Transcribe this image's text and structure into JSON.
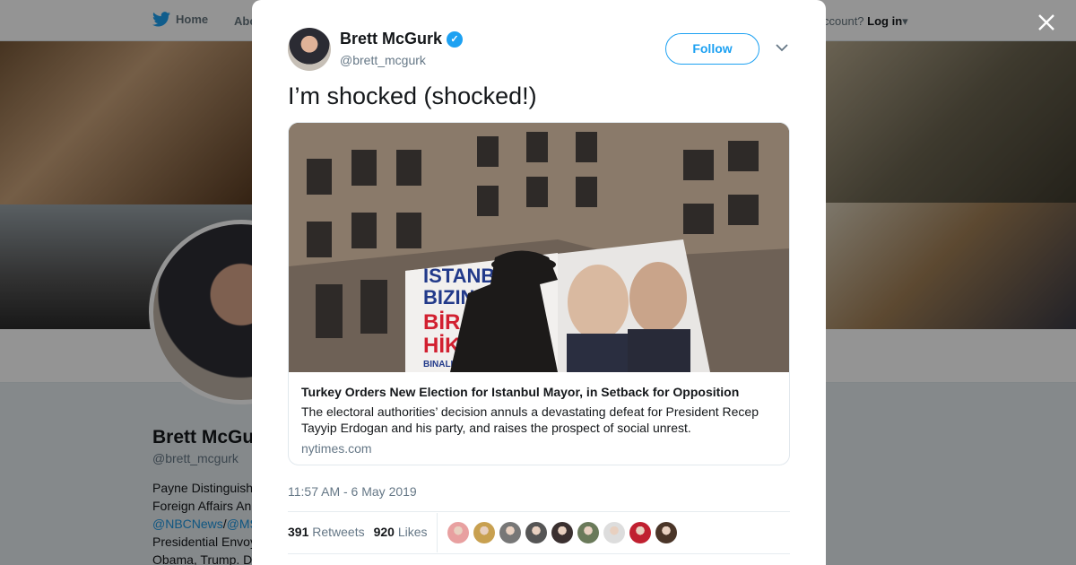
{
  "nav": {
    "home_label": "Home",
    "about_label": "Abo",
    "account_prompt": "ccount?",
    "login_label": "Log in"
  },
  "profile": {
    "name": "Brett McGu",
    "handle": "@brett_mcgurk",
    "bio_lines": [
      "Payne Distinguish",
      "Foreign Affairs An"
    ],
    "bio_link_1": "@NBCNews",
    "bio_link_sep": "/",
    "bio_link_2": "@MS",
    "bio_lines_2": [
      "Presidential Envoy",
      "Obama, Trump. D"
    ]
  },
  "tweet": {
    "author_name": "Brett McGurk",
    "verified_mark": "✓",
    "author_handle": "@brett_mcgurk",
    "follow_label": "Follow",
    "text": "I’m shocked (shocked!)",
    "card": {
      "title": "Turkey Orders New Election for Istanbul Mayor, in Setback for Opposition",
      "description": "The electoral authorities’ decision annuls a devastating defeat for President Recep Tayyip Erdogan and his party, and raises the prospect of social unrest.",
      "domain": "nytimes.com",
      "banner_text": [
        "ISTANB",
        "BIZIN",
        "BİR",
        "HİK",
        "BINALI Y"
      ]
    },
    "timestamp": "11:57 AM - 6 May 2019",
    "retweets_count": "391",
    "retweets_label": "Retweets",
    "likes_count": "920",
    "likes_label": "Likes",
    "liker_colors": [
      "#e8a0a0",
      "#c8a050",
      "#777777",
      "#555555",
      "#3a3030",
      "#6a7a5a",
      "#dddddd",
      "#c02030",
      "#4a3528"
    ]
  },
  "colors": {
    "twitter_blue": "#1da1f2",
    "text_secondary": "#657786"
  }
}
